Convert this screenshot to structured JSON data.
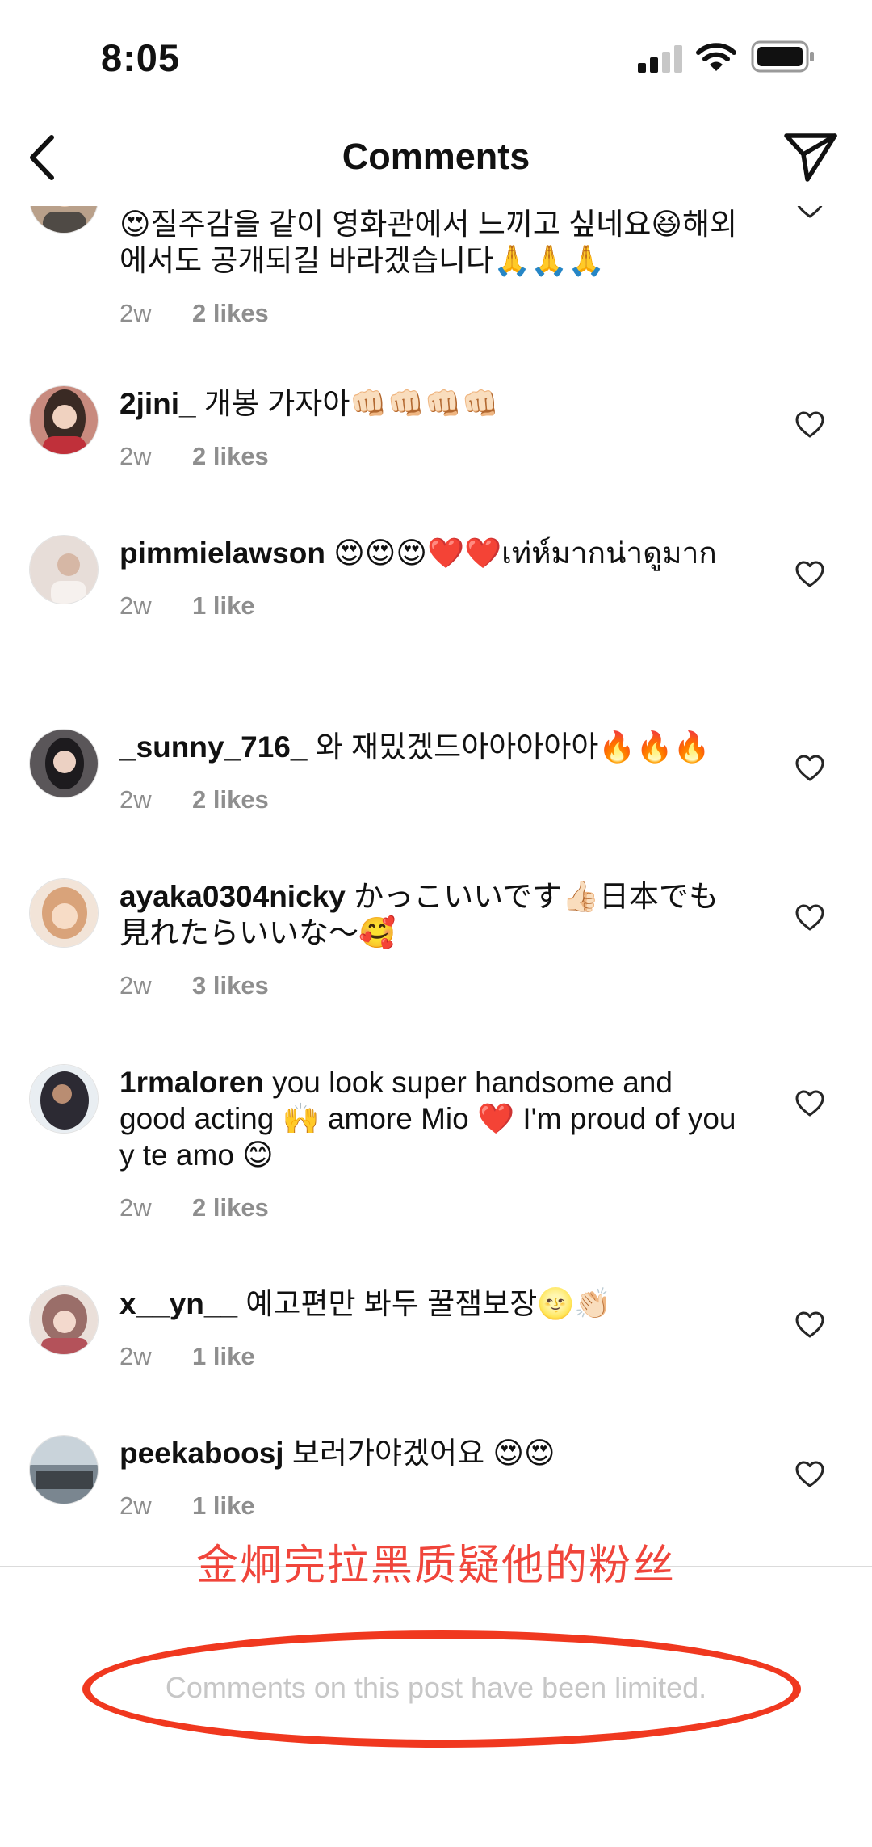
{
  "status_bar": {
    "time": "8:05"
  },
  "header": {
    "title": "Comments"
  },
  "comments": [
    {
      "username": "",
      "text": "😍질주감을 같이 영화관에서 느끼고 싶네요😆해외에서도 공개되길 바라겠습니다🙏🙏🙏",
      "ago": "2w",
      "likes": "2 likes",
      "avatar_color": "#b9a08a"
    },
    {
      "username": "2jini_",
      "text": "개봉 가자아👊🏻👊🏻👊🏻👊🏻",
      "ago": "2w",
      "likes": "2 likes",
      "avatar_color": "#c88a7e"
    },
    {
      "username": "pimmielawson",
      "text": "😍😍😍❤️❤️เท่ห์มากน่าดูมาก",
      "ago": "2w",
      "likes": "1 like",
      "avatar_color": "#e7ddd8"
    },
    {
      "username": "_sunny_716_",
      "text": "와 재밌겠드아아아아아🔥🔥🔥",
      "ago": "2w",
      "likes": "2 likes",
      "avatar_color": "#5a5659"
    },
    {
      "username": "ayaka0304nicky",
      "text": "かっこいいです👍🏻日本でも見れたらいいな～🥰",
      "ago": "2w",
      "likes": "3 likes",
      "avatar_color": "#d9a37a"
    },
    {
      "username": "1rmaloren",
      "text": "you look super handsome and good acting 🙌 amore Mio ❤️ I'm proud of you y te amo 😊",
      "ago": "2w",
      "likes": "2 likes",
      "avatar_color": "#2c2a33"
    },
    {
      "username": "x__yn__",
      "text": "예고편만 봐두 꿀잼보장🌝👏🏻",
      "ago": "2w",
      "likes": "1 like",
      "avatar_color": "#9a6e69"
    },
    {
      "username": "peekaboosj",
      "text": "보러가야겠어요 😍😍",
      "ago": "2w",
      "likes": "1 like",
      "avatar_color": "#7a8690"
    }
  ],
  "overlay_note": "金炯完拉黑质疑他的粉丝",
  "footer": {
    "limited_text": "Comments on this post have been limited."
  }
}
